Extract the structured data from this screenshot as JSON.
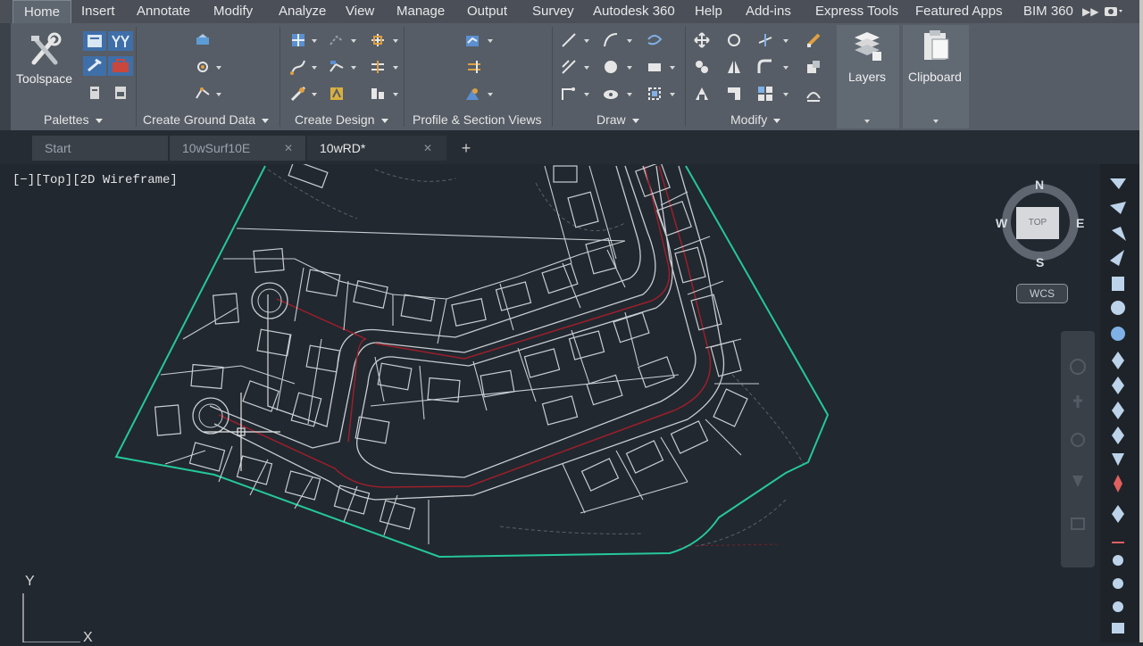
{
  "menubar": {
    "items": [
      "Home",
      "Insert",
      "Annotate",
      "Modify",
      "Analyze",
      "View",
      "Manage",
      "Output",
      "Survey",
      "Autodesk 360",
      "Help",
      "Add-ins",
      "Express Tools",
      "Featured Apps",
      "BIM 360"
    ],
    "active": "Home"
  },
  "ribbon": {
    "toolspace_label": "Toolspace",
    "layers_label": "Layers",
    "clipboard_label": "Clipboard",
    "panels": [
      "Palettes",
      "Create Ground Data",
      "Create Design",
      "Profile & Section Views",
      "Draw",
      "Modify"
    ]
  },
  "tabs": {
    "items": [
      {
        "label": "Start",
        "active": false,
        "closable": false
      },
      {
        "label": "10wSurf10E",
        "active": false,
        "closable": true
      },
      {
        "label": "10wRD*",
        "active": true,
        "closable": true
      }
    ],
    "add_label": "+"
  },
  "viewport": {
    "label": "[−][Top][2D Wireframe]",
    "viewcube": {
      "n": "N",
      "s": "S",
      "e": "E",
      "w": "W",
      "top": "TOP",
      "wcs": "WCS"
    },
    "ucs": {
      "x": "X",
      "y": "Y"
    }
  },
  "colors": {
    "background": "#212830",
    "boundary": "#25c79b",
    "road_centerline": "#9c1f2a",
    "lot_lines": "#c8cdd2"
  }
}
